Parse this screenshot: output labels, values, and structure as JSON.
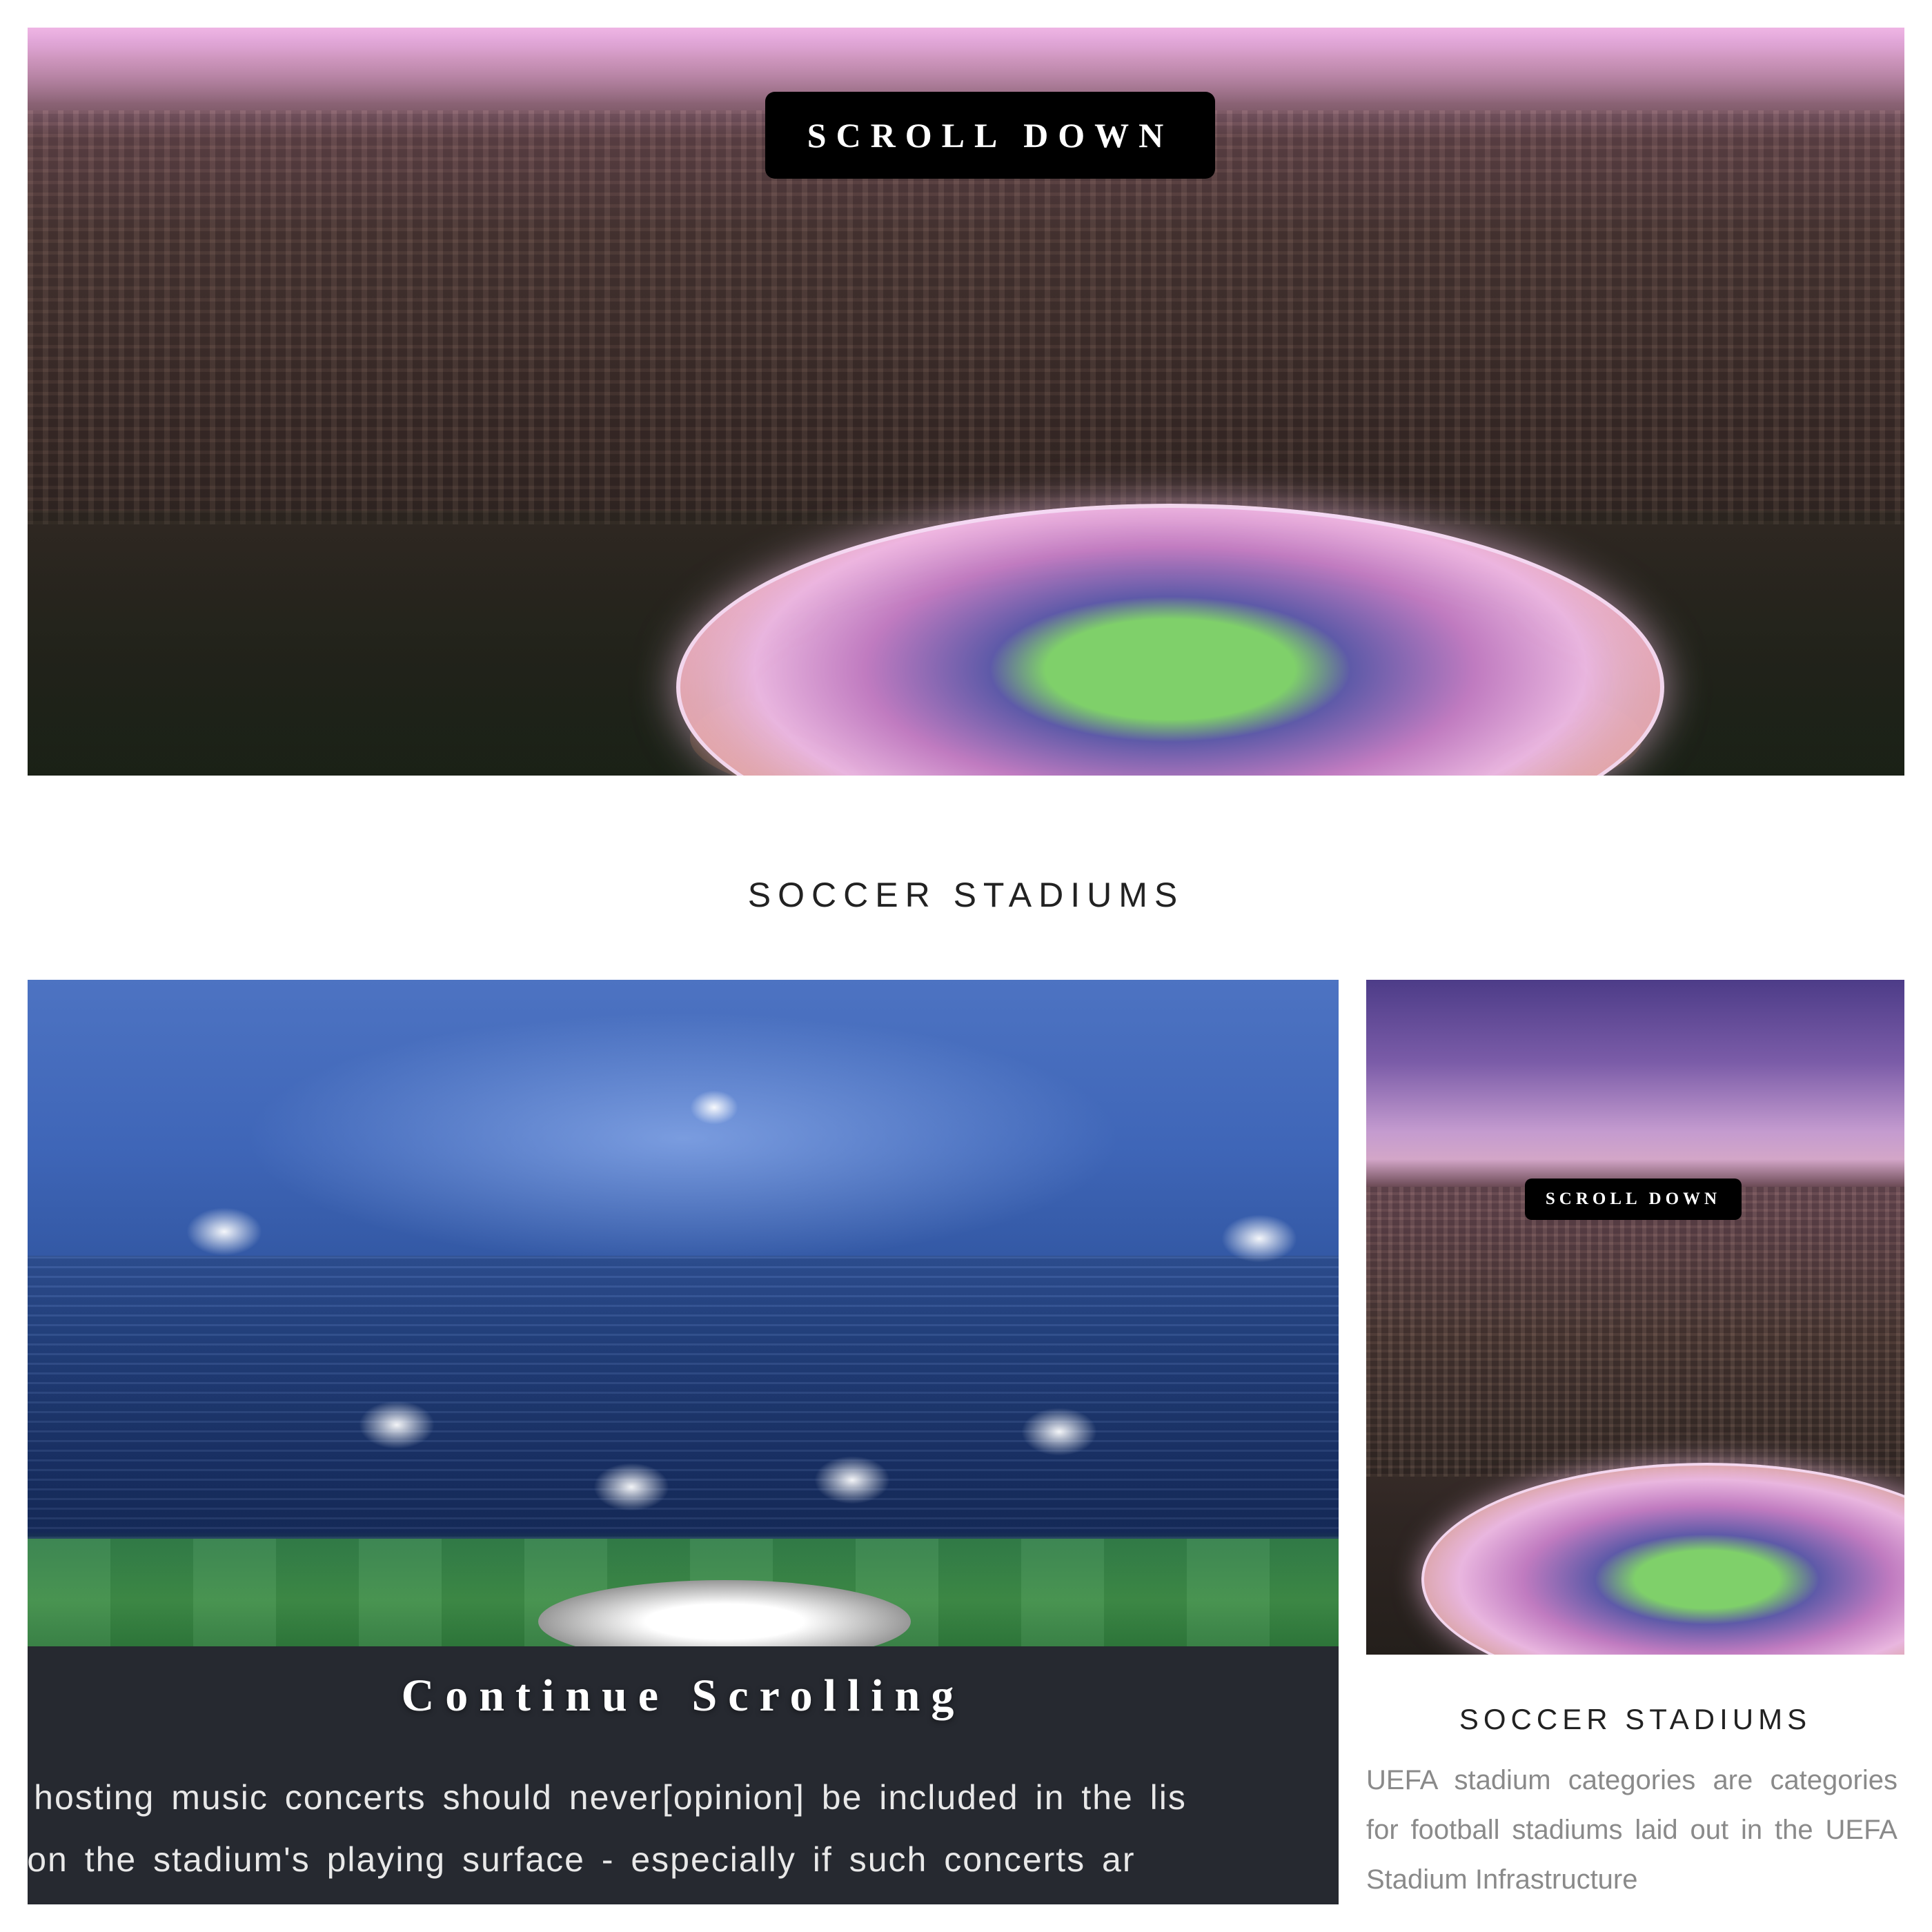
{
  "hero": {
    "button_label": "SCROLL DOWN",
    "image_alt": "stadium-aerial-city-image"
  },
  "section": {
    "title": "SOCCER STADIUMS"
  },
  "card_left": {
    "overlay_text": "Continue Scrolling",
    "body_lines": [
      "s for hosting music concerts should never[opinion] be included in the lis",
      "tand on the stadium's playing surface - especially if such concerts ar"
    ]
  },
  "card_right": {
    "button_label": "SCROLL DOWN",
    "title": "SOCCER STADIUMS",
    "body": "UEFA stadium categories are categories for football stadiums laid out in the UEFA Stadium Infrastructure"
  },
  "colors": {
    "dark_panel": "#262930",
    "button_bg": "#000000",
    "body_text_gray": "#8a8a8a"
  }
}
